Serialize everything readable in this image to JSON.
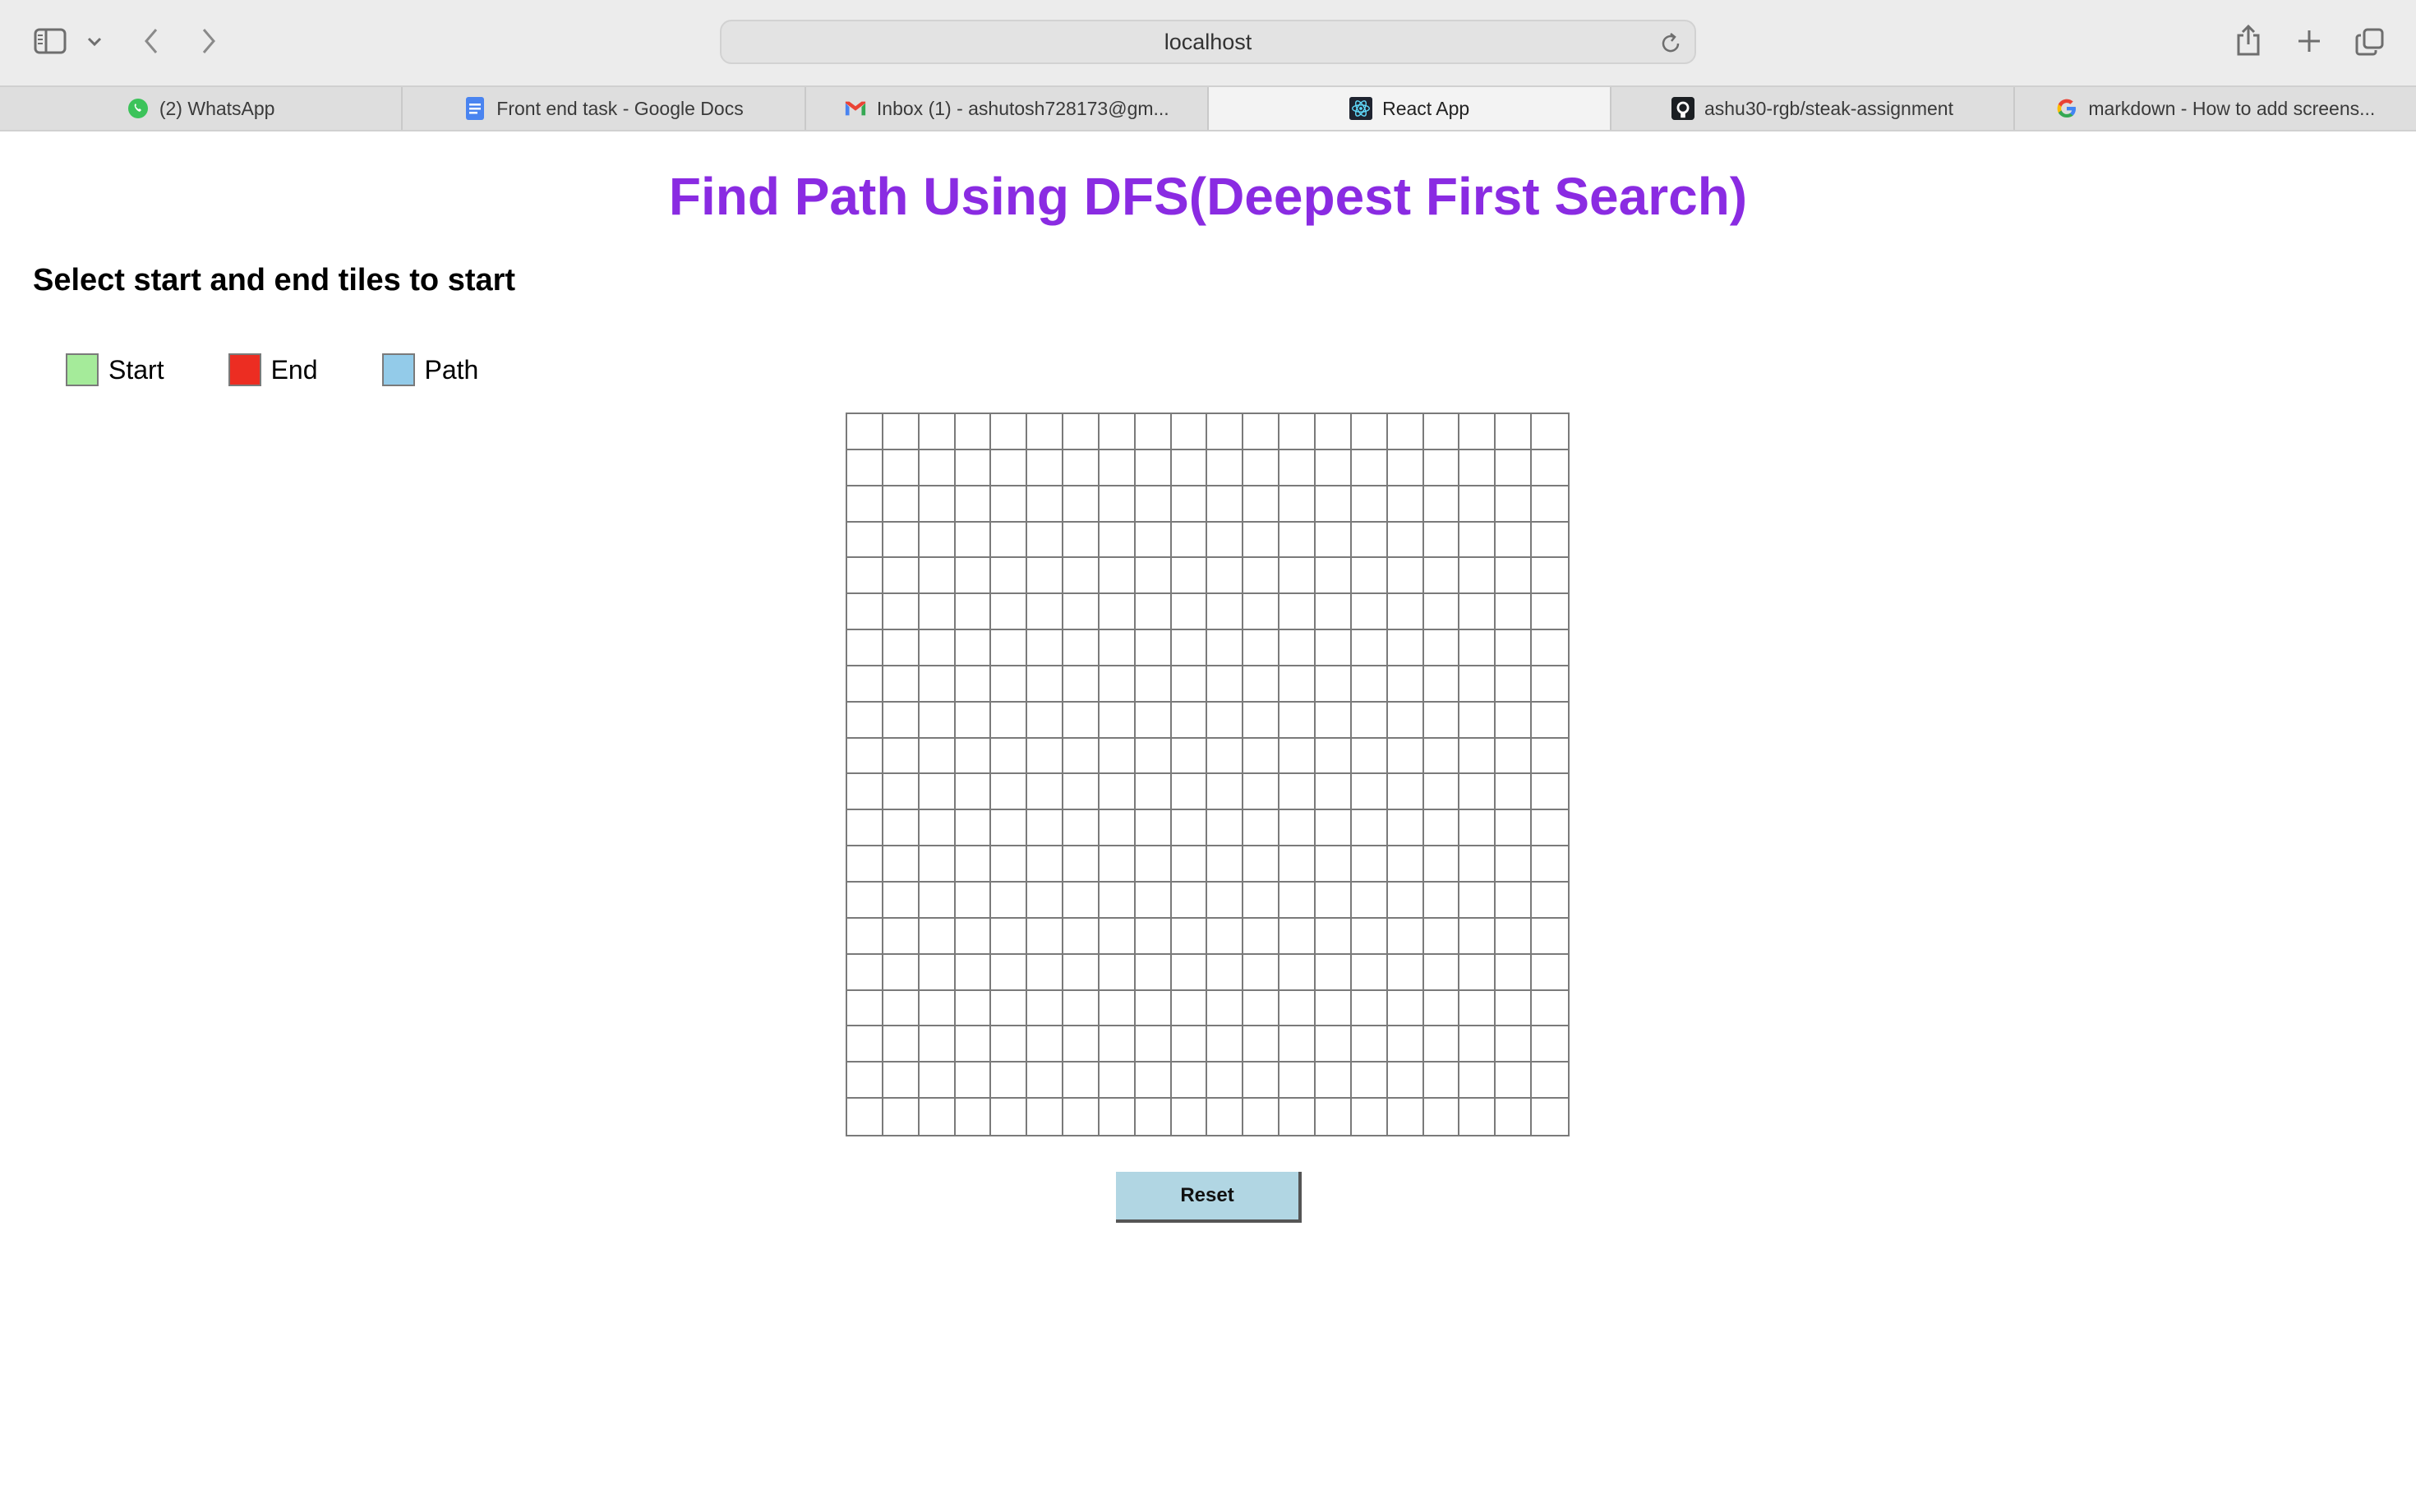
{
  "browser": {
    "url": "localhost",
    "tabs": [
      {
        "label": "(2) WhatsApp",
        "icon": "whatsapp-icon",
        "active": false
      },
      {
        "label": "Front end task - Google Docs",
        "icon": "google-docs-icon",
        "active": false
      },
      {
        "label": "Inbox (1) - ashutosh728173@gm...",
        "icon": "gmail-icon",
        "active": false
      },
      {
        "label": "React App",
        "icon": "react-icon",
        "active": true
      },
      {
        "label": "ashu30-rgb/steak-assignment",
        "icon": "github-icon",
        "active": false
      },
      {
        "label": "markdown - How to add screens...",
        "icon": "google-icon",
        "active": false
      }
    ]
  },
  "page": {
    "title": "Find Path Using DFS(Deepest First Search)",
    "subtitle": "Select start and end tiles to start",
    "legend": [
      {
        "label": "Start",
        "color": "#a5eb9a"
      },
      {
        "label": "End",
        "color": "#ec2d22"
      },
      {
        "label": "Path",
        "color": "#93cbe9"
      }
    ],
    "grid": {
      "rows": 20,
      "cols": 20
    },
    "reset_label": "Reset"
  },
  "colors": {
    "title": "#8a2be2",
    "reset_button": "#b1d6e3",
    "grid_line": "#7a7a7a"
  }
}
